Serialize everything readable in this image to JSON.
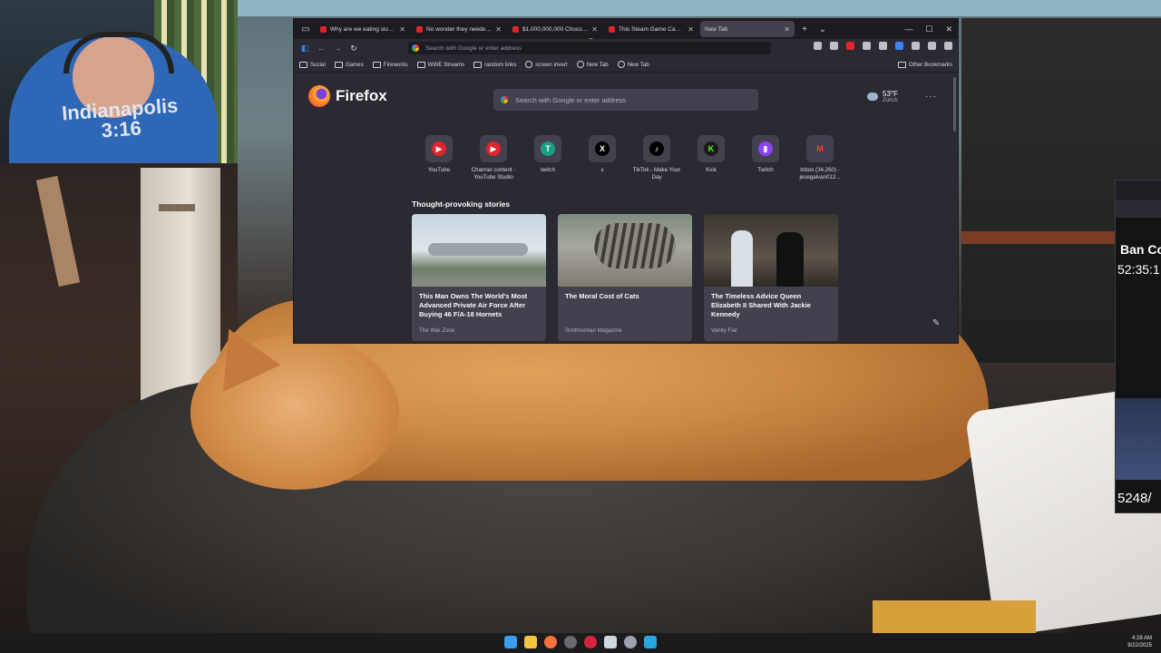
{
  "webcam": {
    "shirt_text": "Indianapolis 3:16"
  },
  "browser": {
    "tabs": [
      {
        "label": "Why are we eating slop? - Yo",
        "favicon": "youtube",
        "active": false
      },
      {
        "label": "No wonder they needed so m",
        "favicon": "youtube",
        "active": false
      },
      {
        "label": "$1,000,000,000 Chocolate Fac",
        "favicon": "youtube",
        "active": false
      },
      {
        "label": "This Steam Game Can Steal Yo",
        "favicon": "youtube",
        "active": false
      },
      {
        "label": "New Tab",
        "favicon": "firefox",
        "active": true
      }
    ],
    "urlbar_placeholder": "Search with Google or enter address",
    "bookmarks": [
      {
        "label": "Social",
        "type": "folder"
      },
      {
        "label": "Games",
        "type": "folder"
      },
      {
        "label": "Fireworks",
        "type": "folder"
      },
      {
        "label": "WWE Streams",
        "type": "folder"
      },
      {
        "label": "random links",
        "type": "folder"
      },
      {
        "label": "screen invert",
        "type": "link"
      },
      {
        "label": "New Tab",
        "type": "link"
      },
      {
        "label": "New Tab",
        "type": "link"
      }
    ],
    "other_bookmarks": "Other Bookmarks"
  },
  "newtab": {
    "brand": "Firefox",
    "search_placeholder": "Search with Google or enter address",
    "weather": {
      "temp": "53°F",
      "city": "Zurich"
    },
    "shortcuts": [
      {
        "label": "YouTube",
        "icon": "youtube-icon",
        "color": "#e0242c",
        "glyph": "▶"
      },
      {
        "label": "Channel content - YouTube Studio",
        "icon": "youtube-studio-icon",
        "color": "#e0242c",
        "glyph": "▶"
      },
      {
        "label": "twitch",
        "icon": "letter-t-icon",
        "color": "#1a9e82",
        "glyph": "T"
      },
      {
        "label": "x",
        "icon": "x-icon",
        "color": "#000000",
        "glyph": "X"
      },
      {
        "label": "TikTok - Make Your Day",
        "icon": "tiktok-icon",
        "color": "#000000",
        "glyph": "♪"
      },
      {
        "label": "Kick",
        "icon": "kick-icon",
        "color": "#1a1a1a",
        "glyph": "K"
      },
      {
        "label": "Twitch",
        "icon": "twitch-icon",
        "color": "#8b44f7",
        "glyph": "▮"
      },
      {
        "label": "Inbox (34,260) - jesegalvan012...",
        "icon": "gmail-icon",
        "color": "#42414d",
        "glyph": "M"
      }
    ],
    "stories_heading": "Thought-provoking stories",
    "stories": [
      {
        "title": "This Man Owns The World's Most Advanced Private Air Force After Buying 46 F/A-18 Hornets",
        "source": "The War Zone"
      },
      {
        "title": "The Moral Cost of Cats",
        "source": "Smithsonian Magazine"
      },
      {
        "title": "The Timeless Advice Queen Elizabeth II Shared With Jackie Kennedy",
        "source": "Vanity Fair"
      }
    ]
  },
  "peek_window": {
    "title": "Ban Co",
    "timer": "52:35:1",
    "count": "5248/"
  },
  "taskbar": {
    "time": "4:28 AM",
    "date": "9/22/2025"
  }
}
